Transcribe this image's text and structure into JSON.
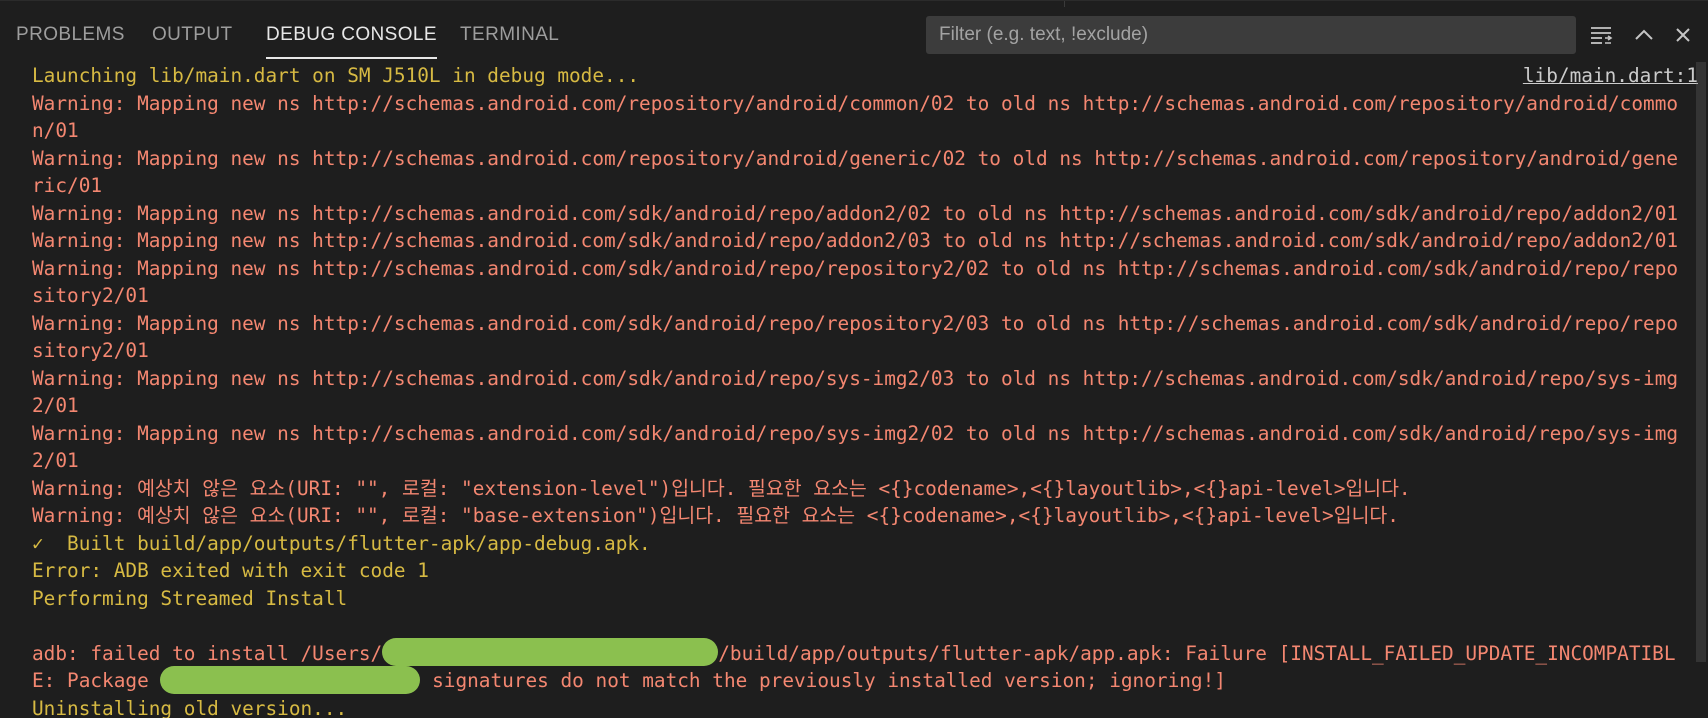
{
  "tabs": {
    "problems": "PROBLEMS",
    "output": "OUTPUT",
    "debug_console": "DEBUG CONSOLE",
    "terminal": "TERMINAL"
  },
  "filter": {
    "placeholder": "Filter (e.g. text, !exclude)",
    "value": ""
  },
  "toolbar_icons": [
    "word-wrap-icon",
    "chevron-up-icon",
    "close-icon"
  ],
  "source_link": "lib/main.dart:1",
  "console_lines": [
    "Launching lib/main.dart on SM J510L in debug mode...",
    "Warning: Mapping new ns http://schemas.android.com/repository/android/common/02 to old ns http://schemas.android.com/repository/android/commo",
    "n/01",
    "Warning: Mapping new ns http://schemas.android.com/repository/android/generic/02 to old ns http://schemas.android.com/repository/android/gene",
    "ric/01",
    "Warning: Mapping new ns http://schemas.android.com/sdk/android/repo/addon2/02 to old ns http://schemas.android.com/sdk/android/repo/addon2/01",
    "Warning: Mapping new ns http://schemas.android.com/sdk/android/repo/addon2/03 to old ns http://schemas.android.com/sdk/android/repo/addon2/01",
    "Warning: Mapping new ns http://schemas.android.com/sdk/android/repo/repository2/02 to old ns http://schemas.android.com/sdk/android/repo/repo",
    "sitory2/01",
    "Warning: Mapping new ns http://schemas.android.com/sdk/android/repo/repository2/03 to old ns http://schemas.android.com/sdk/android/repo/repo",
    "sitory2/01",
    "Warning: Mapping new ns http://schemas.android.com/sdk/android/repo/sys-img2/03 to old ns http://schemas.android.com/sdk/android/repo/sys-img",
    "2/01",
    "Warning: Mapping new ns http://schemas.android.com/sdk/android/repo/sys-img2/02 to old ns http://schemas.android.com/sdk/android/repo/sys-img",
    "2/01",
    "Warning: 예상치 않은 요소(URI: \"\", 로컬: \"extension-level\")입니다. 필요한 요소는 <{}codename>,<{}layoutlib>,<{}api-level>입니다.",
    "Warning: 예상치 않은 요소(URI: \"\", 로컬: \"base-extension\")입니다. 필요한 요소는 <{}codename>,<{}layoutlib>,<{}api-level>입니다.",
    "✓  Built build/app/outputs/flutter-apk/app-debug.apk.",
    "Error: ADB exited with exit code 1",
    "Performing Streamed Install",
    "",
    "adb: failed to install /Users/",
    "/build/app/outputs/flutter-apk/app.apk: Failure [INSTALL_FAILED_UPDATE_INCOMPATIBL",
    "E: Package ",
    " signatures do not match the previously installed version; ignoring!]",
    "Uninstalling old version..."
  ],
  "colors": {
    "background": "#1e1e1e",
    "info_yellow": "#d7ba43",
    "warning_orange": "#f48771",
    "redaction_green": "#8bc04f"
  }
}
